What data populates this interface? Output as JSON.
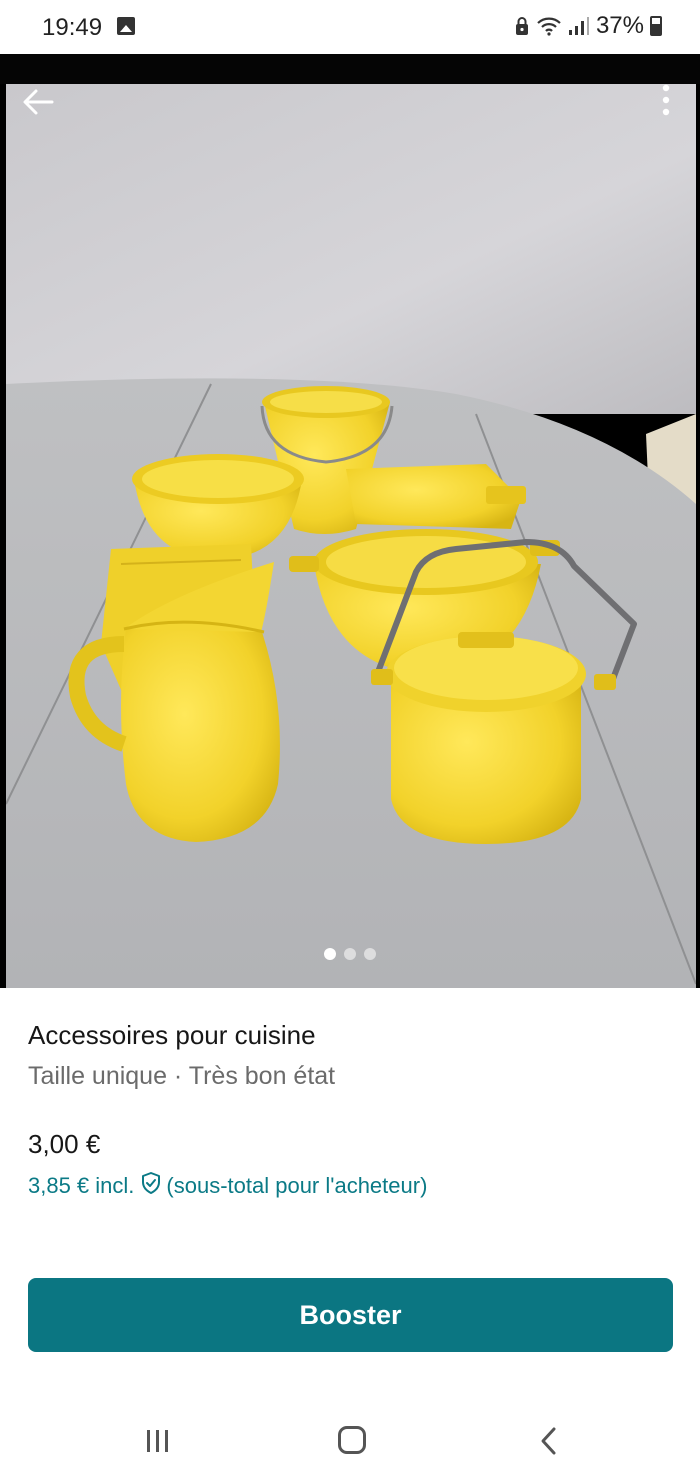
{
  "status_bar": {
    "time": "19:49",
    "battery": "37%",
    "icons": [
      "gallery-icon",
      "lock-icon",
      "wifi-icon",
      "signal-icon",
      "battery-icon"
    ]
  },
  "photo": {
    "icons": [
      "back-arrow-icon",
      "more-vertical-icon"
    ],
    "pagination": {
      "count": 3,
      "active_index": 0
    }
  },
  "listing": {
    "title": "Accessoires pour cuisine",
    "meta": "Taille unique · Très bon état",
    "price": "3,00 €",
    "buyer_price": "3,85 € incl.",
    "buyer_note": "(sous-total pour l'acheteur)"
  },
  "actions": {
    "booster_label": "Booster"
  },
  "colors": {
    "accent": "#0b7682",
    "buyer_text": "#0b7a86",
    "product_yellow": "#f2d42a"
  },
  "nav_bar": {
    "icons": [
      "recent-apps-icon",
      "home-icon",
      "nav-back-icon"
    ]
  }
}
